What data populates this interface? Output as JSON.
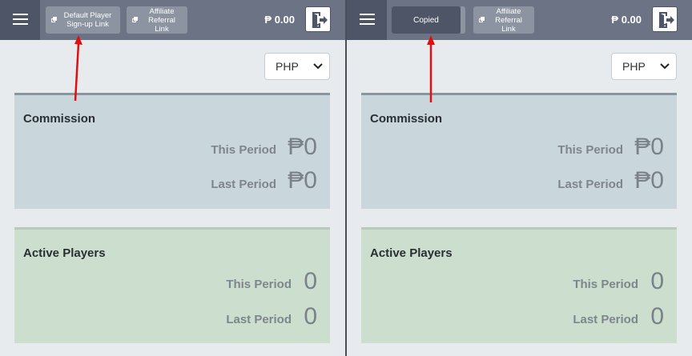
{
  "left_panel": {
    "topbar": {
      "default_link_label": "Default Player Sign-up Link",
      "default_link_line1": "Default Player",
      "default_link_line2": "Sign-up Link",
      "affiliate_line1": "Affiliate",
      "affiliate_line2": "Referral",
      "affiliate_line3": "Link",
      "balance": "₱ 0.00"
    },
    "currency": "PHP",
    "commission": {
      "title": "Commission",
      "this_period_label": "This Period",
      "this_period_value": "₱0",
      "last_period_label": "Last Period",
      "last_period_value": "₱0"
    },
    "players": {
      "title": "Active Players",
      "this_period_label": "This Period",
      "this_period_value": "0",
      "last_period_label": "Last Period",
      "last_period_value": "0"
    }
  },
  "right_panel": {
    "topbar": {
      "copied_label": "Copied",
      "affiliate_line1": "Affiliate",
      "affiliate_line2": "Referral",
      "affiliate_line3": "Link",
      "balance": "₱ 0.00"
    },
    "currency": "PHP",
    "commission": {
      "title": "Commission",
      "this_period_label": "This Period",
      "this_period_value": "₱0",
      "last_period_label": "Last Period",
      "last_period_value": "₱0"
    },
    "players": {
      "title": "Active Players",
      "this_period_label": "This Period",
      "this_period_value": "0",
      "last_period_label": "Last Period",
      "last_period_value": "0"
    }
  },
  "icons": [
    "menu-icon",
    "copy-icon",
    "logout-icon",
    "chevron-down-icon"
  ],
  "colors": {
    "topbar": "#6b7384",
    "topbar_dark": "#4d5566",
    "commission_card": "#c9d7dc",
    "players_card": "#ccdfcf",
    "annotation_arrow": "#e01010"
  }
}
